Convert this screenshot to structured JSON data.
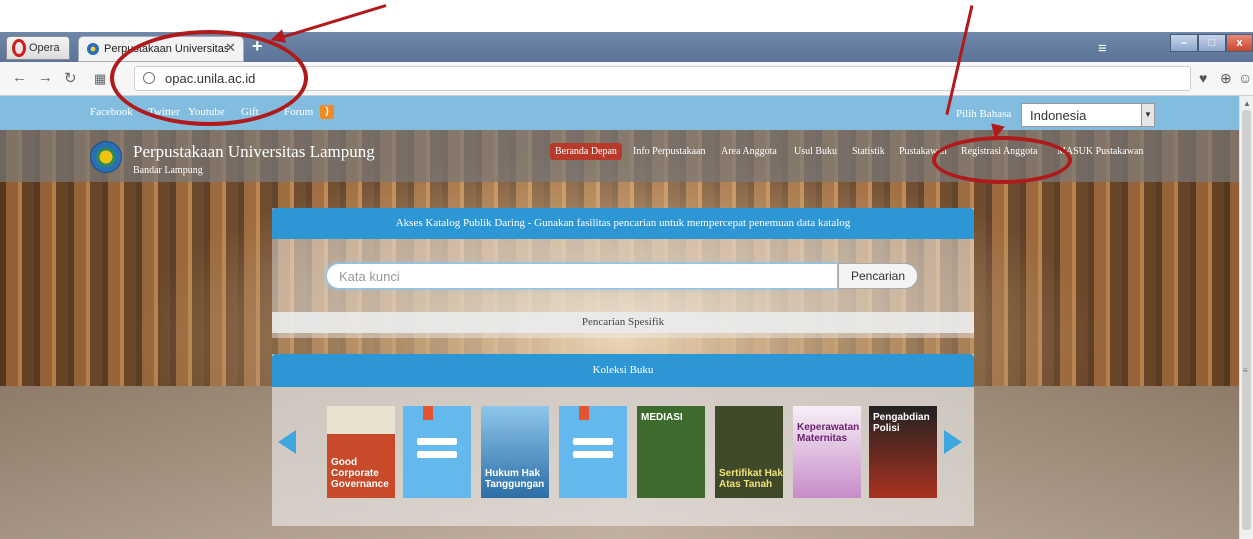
{
  "browser": {
    "opera_label": "Opera",
    "tab_title": "Perpustakaan Universitas Lampung",
    "tab_close": "✕",
    "new_tab": "+",
    "url": "opac.unila.ac.id"
  },
  "top_strip": {
    "social_links": [
      "Facebook",
      "Twitter",
      "Youtube",
      "Gift",
      "Forum"
    ],
    "language_label": "Pilih Bahasa",
    "language_value": "Indonesia"
  },
  "header": {
    "title": "Perpustakaan Universitas Lampung",
    "subtitle": "Bandar Lampung",
    "menu": [
      "Beranda Depan",
      "Info Perpustakaan",
      "Area Anggota",
      "Usul Buku",
      "Statistik",
      "Pustakawan",
      "Registrasi Anggota",
      "MASUK Pustakawan"
    ]
  },
  "search": {
    "heading": "Akses Katalog Publik Daring - Gunakan fasilitas pencarian untuk mempercepat penemuan data katalog",
    "placeholder": "Kata kunci",
    "button": "Pencarian",
    "specific": "Pencarian Spesifik"
  },
  "collection": {
    "heading": "Koleksi Buku",
    "books": [
      {
        "title": "Good Corporate Governance",
        "color": "#c9492b"
      },
      {
        "title": "",
        "color": "#63b8ee"
      },
      {
        "title": "Hukum Hak Tanggungan",
        "color": "#2b6ea6"
      },
      {
        "title": "",
        "color": "#63b8ee"
      },
      {
        "title": "MEDIASI",
        "color": "#3d6b2e"
      },
      {
        "title": "Sertifikat Hak Atas Tanah",
        "color": "#3f4a2a"
      },
      {
        "title": "Keperawatan Maternitas",
        "color": "#8a3f8f"
      },
      {
        "title": "Pengabdian Polisi",
        "color": "#a8321f"
      }
    ]
  },
  "colors": {
    "accent": "#2d97d6",
    "active_menu": "#b73a2a",
    "annotation": "#b01a1a"
  }
}
